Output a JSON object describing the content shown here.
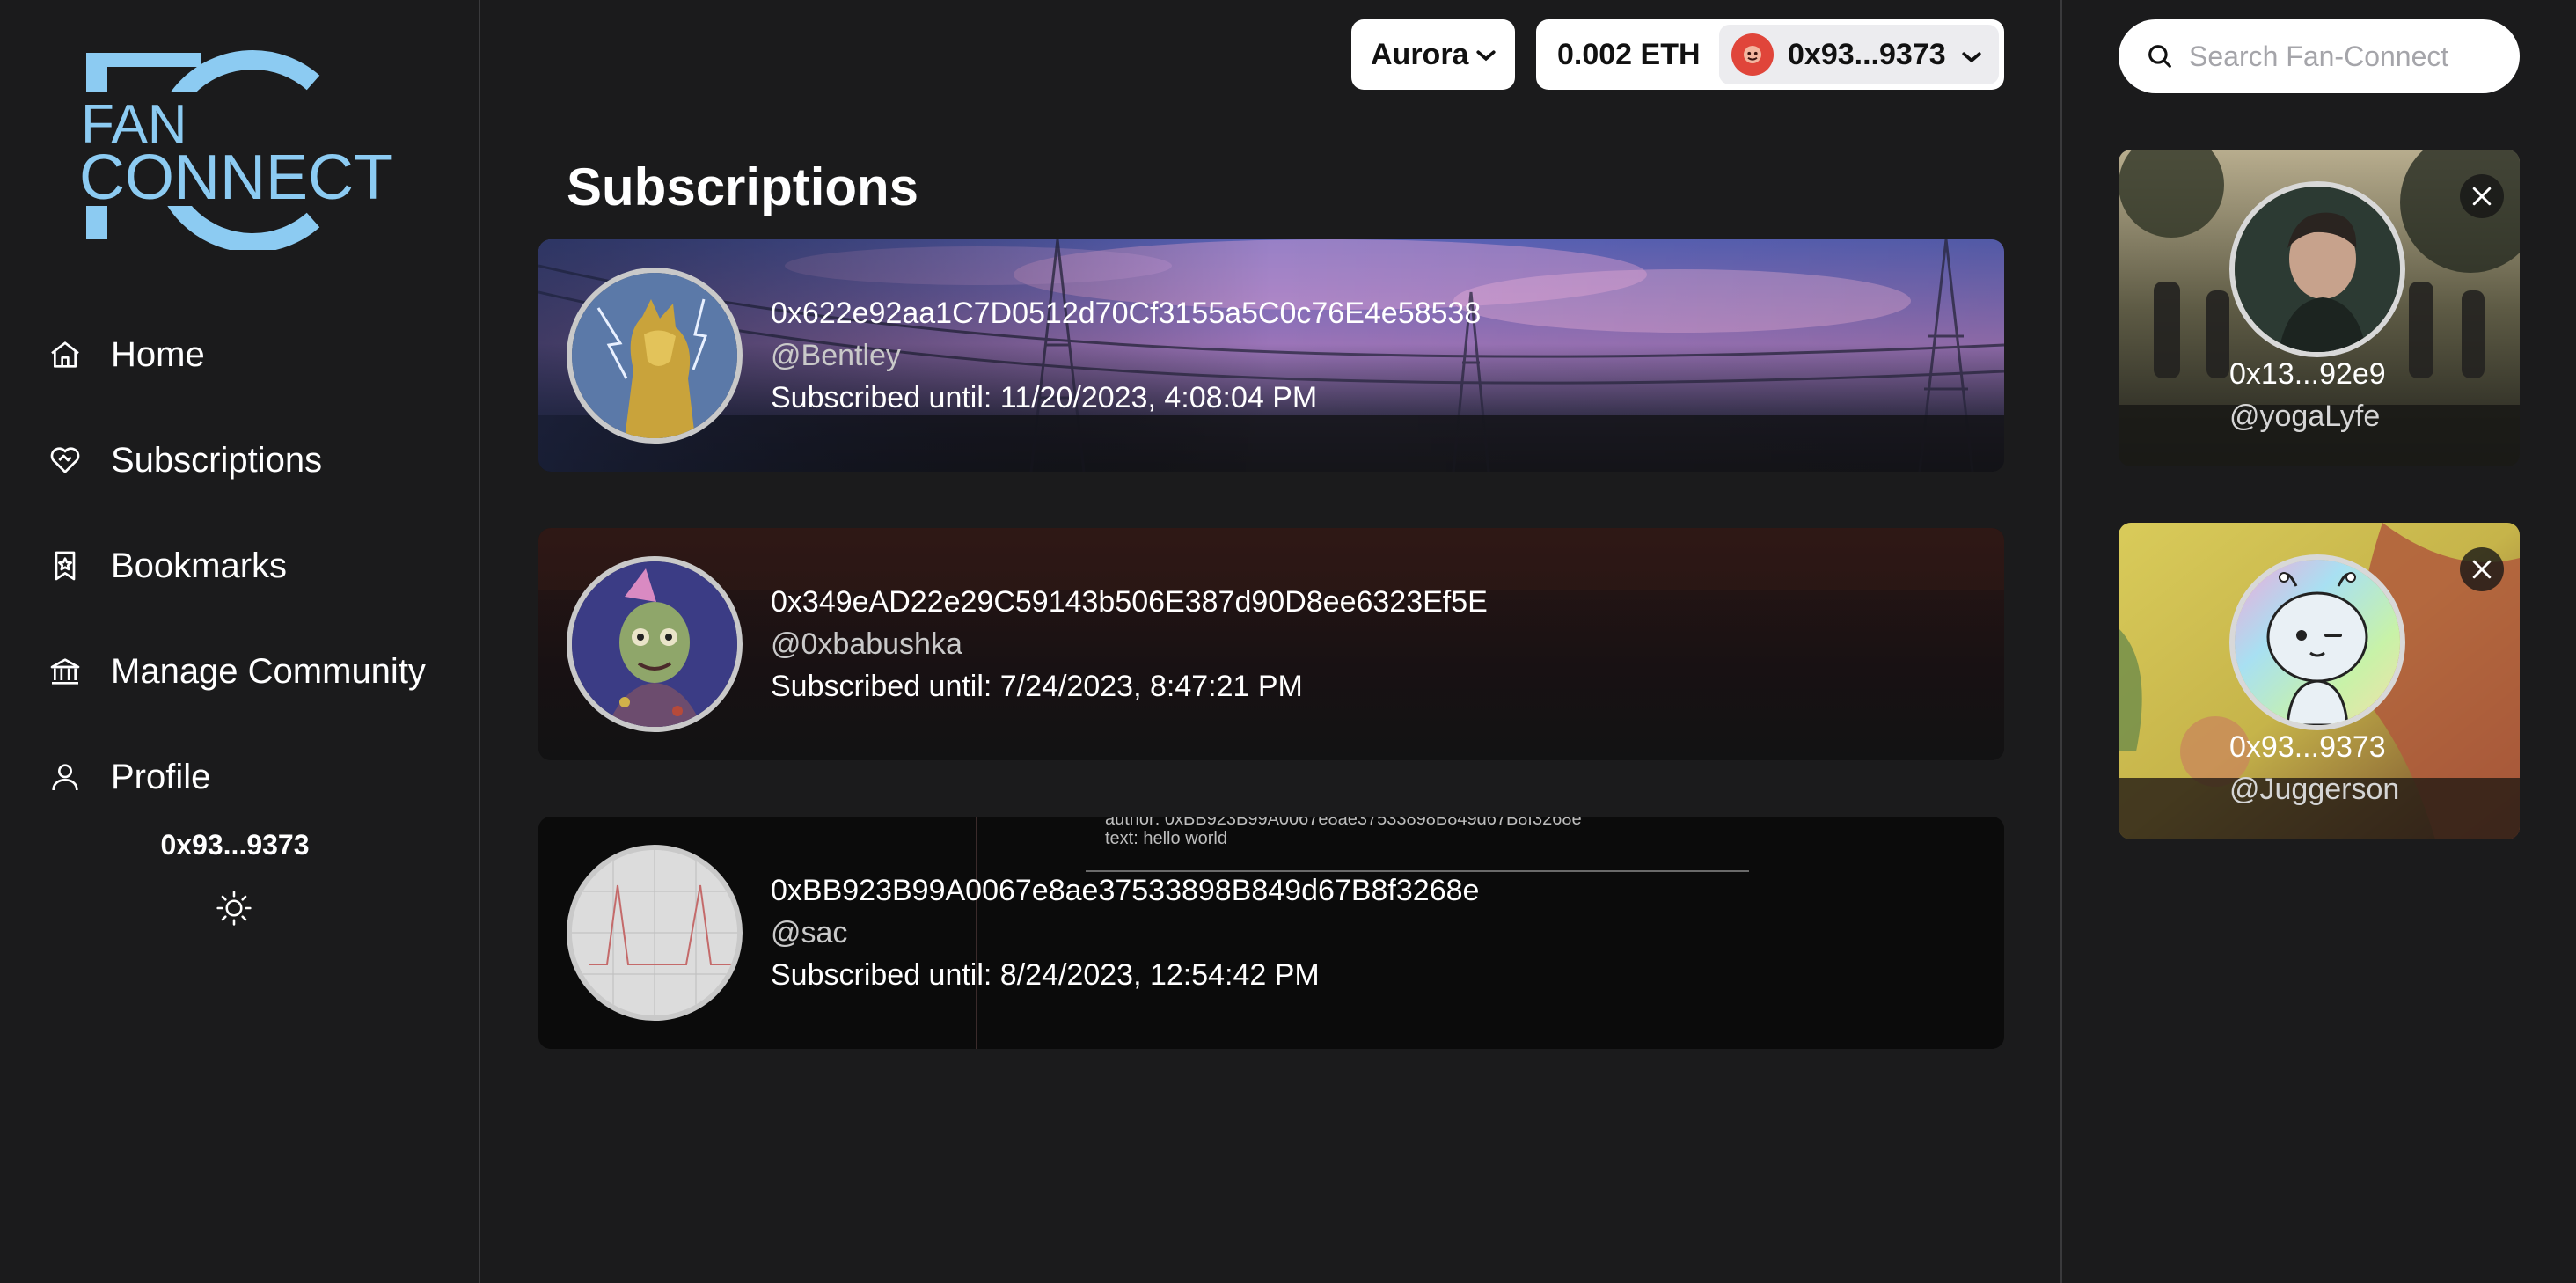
{
  "logo": {
    "line1": "FAN",
    "line2": "CONNECT",
    "monogram": "FC"
  },
  "nav": [
    {
      "label": "Home",
      "icon": "home-icon"
    },
    {
      "label": "Subscriptions",
      "icon": "heart-handshake-icon"
    },
    {
      "label": "Bookmarks",
      "icon": "bookmark-star-icon"
    },
    {
      "label": "Manage Community",
      "icon": "bank-icon"
    },
    {
      "label": "Profile",
      "icon": "user-icon"
    }
  ],
  "sidebar_user": "0x93...9373",
  "theme_icon": "sun-icon",
  "network": {
    "selected": "Aurora"
  },
  "wallet": {
    "balance": "0.002 ETH",
    "address": "0x93...9373"
  },
  "page_title": "Subscriptions",
  "subscriptions": [
    {
      "address": "0x622e92aa1C7D0512d70Cf3155a5C0c76E4e58538",
      "handle": "@Bentley",
      "until": "Subscribed until: 11/20/2023, 4:08:04 PM"
    },
    {
      "address": "0x349eAD22e29C59143b506E387d90D8ee6323Ef5E",
      "handle": "@0xbabushka",
      "until": "Subscribed until: 7/24/2023, 8:47:21 PM"
    },
    {
      "address": "0xBB923B99A0067e8ae37533898B849d67B8f3268e",
      "handle": "@sac",
      "until": "Subscribed until: 8/24/2023, 12:54:42 PM"
    }
  ],
  "card3_overlay": {
    "author_line": "author: 0xBB923B99A0067e8ae37533898B849d67B8f3268e",
    "text_line": "text: hello world"
  },
  "search": {
    "placeholder": "Search Fan-Connect"
  },
  "suggestions": [
    {
      "address": "0x13...92e9",
      "handle": "@yogaLyfe"
    },
    {
      "address": "0x93...9373",
      "handle": "@Juggerson"
    }
  ],
  "colors": {
    "background": "#1b1b1c",
    "logo_blue": "#8ccbf2",
    "text": "#ffffff",
    "muted": "#c9c9c9"
  }
}
